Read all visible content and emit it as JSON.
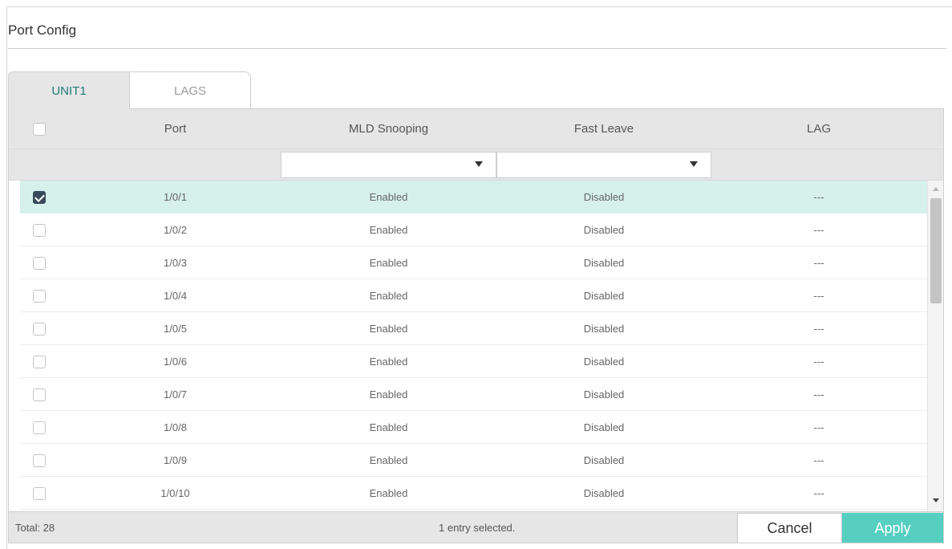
{
  "page": {
    "title": "Port Config"
  },
  "tabs": [
    {
      "label": "UNIT1",
      "active": true
    },
    {
      "label": "LAGS",
      "active": false
    }
  ],
  "table": {
    "headers": {
      "port": "Port",
      "mld": "MLD Snooping",
      "fast_leave": "Fast Leave",
      "lag": "LAG"
    },
    "filters": {
      "mld": "",
      "fast_leave": ""
    },
    "rows": [
      {
        "checked": true,
        "port": "1/0/1",
        "mld": "Enabled",
        "fast_leave": "Disabled",
        "lag": "---"
      },
      {
        "checked": false,
        "port": "1/0/2",
        "mld": "Enabled",
        "fast_leave": "Disabled",
        "lag": "---"
      },
      {
        "checked": false,
        "port": "1/0/3",
        "mld": "Enabled",
        "fast_leave": "Disabled",
        "lag": "---"
      },
      {
        "checked": false,
        "port": "1/0/4",
        "mld": "Enabled",
        "fast_leave": "Disabled",
        "lag": "---"
      },
      {
        "checked": false,
        "port": "1/0/5",
        "mld": "Enabled",
        "fast_leave": "Disabled",
        "lag": "---"
      },
      {
        "checked": false,
        "port": "1/0/6",
        "mld": "Enabled",
        "fast_leave": "Disabled",
        "lag": "---"
      },
      {
        "checked": false,
        "port": "1/0/7",
        "mld": "Enabled",
        "fast_leave": "Disabled",
        "lag": "---"
      },
      {
        "checked": false,
        "port": "1/0/8",
        "mld": "Enabled",
        "fast_leave": "Disabled",
        "lag": "---"
      },
      {
        "checked": false,
        "port": "1/0/9",
        "mld": "Enabled",
        "fast_leave": "Disabled",
        "lag": "---"
      },
      {
        "checked": false,
        "port": "1/0/10",
        "mld": "Enabled",
        "fast_leave": "Disabled",
        "lag": "---"
      }
    ]
  },
  "footer": {
    "total": "Total: 28",
    "selected": "1 entry selected.",
    "cancel_label": "Cancel",
    "apply_label": "Apply"
  },
  "colors": {
    "accent": "#56cfc1",
    "selected_row": "#d6f0ec",
    "header_bg": "#e6e6e6"
  },
  "icons": {
    "dropdown": "chevron-down-icon",
    "checkbox": "checkbox-icon"
  }
}
